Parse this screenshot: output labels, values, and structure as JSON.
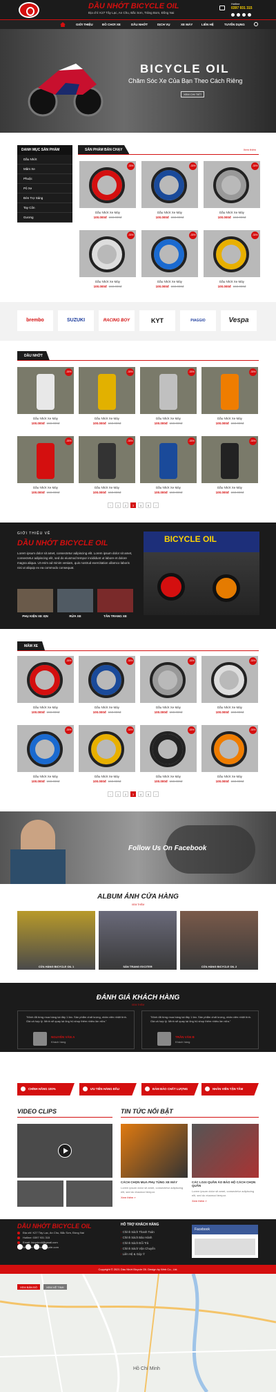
{
  "header": {
    "site_name": "DẦU NHỚT BICYCLE OIL",
    "address": "Địa chỉ: K27 Tây Lạc, An Chu, Bắc Sơn, Trảng Bom, Đồng Nai",
    "hotline_label": "Hotline",
    "hotline": "0397 931 315"
  },
  "nav": {
    "items": [
      "GIỚI THIỆU",
      "ĐỒ CHƠI XE",
      "DẦU NHỚT",
      "DỊCH VỤ",
      "XE MÁY",
      "LIÊN HỆ",
      "TUYỂN DỤNG"
    ]
  },
  "hero": {
    "title": "BICYCLE OIL",
    "subtitle": "Chăm Sóc Xe Của Bạn Theo Cách Riêng",
    "button": "XEM CHI TIẾT"
  },
  "sidebar": {
    "title": "DANH MỤC SẢN PHẨM",
    "items": [
      "Dầu Nhớt",
      "Mâm Xe",
      "Phuộc",
      "Pô Xe",
      "Đèn Trợ Sáng",
      "Tay Côn",
      "Gương"
    ]
  },
  "bestsellers": {
    "title": "SẢN PHẨM BÁN CHẠY",
    "see_all": "Xem thêm",
    "products": [
      {
        "name": "Dầu Nhớt Xe Máy",
        "price": "100.000đ",
        "old": "150.000đ",
        "badge": "-33%"
      },
      {
        "name": "Dầu Nhớt Xe Máy",
        "price": "100.000đ",
        "old": "150.000đ",
        "badge": "-33%"
      },
      {
        "name": "Dầu Nhớt Xe Máy",
        "price": "100.000đ",
        "old": "150.000đ",
        "badge": "-33%"
      },
      {
        "name": "Dầu Nhớt Xe Máy",
        "price": "100.000đ",
        "old": "150.000đ",
        "badge": "-33%"
      },
      {
        "name": "Dầu Nhớt Xe Máy",
        "price": "100.000đ",
        "old": "150.000đ",
        "badge": "-33%"
      },
      {
        "name": "Dầu Nhớt Xe Máy",
        "price": "100.000đ",
        "old": "150.000đ",
        "badge": "-33%"
      }
    ]
  },
  "brands": [
    "brembo",
    "SUZUKI",
    "RACING BOY",
    "KYT",
    "PIAGGIO",
    "Vespa"
  ],
  "oil": {
    "title": "DẦU NHỚT",
    "products": [
      {
        "name": "Dầu Nhớt Xe Máy",
        "price": "100.000đ",
        "old": "150.000đ",
        "badge": "-33%"
      },
      {
        "name": "Dầu Nhớt Xe Máy",
        "price": "100.000đ",
        "old": "150.000đ",
        "badge": "-33%"
      },
      {
        "name": "Dầu Nhớt Xe Máy",
        "price": "100.000đ",
        "old": "150.000đ",
        "badge": "-33%"
      },
      {
        "name": "Dầu Nhớt Xe Máy",
        "price": "100.000đ",
        "old": "150.000đ",
        "badge": "-33%"
      },
      {
        "name": "Dầu Nhớt Xe Máy",
        "price": "100.000đ",
        "old": "150.000đ",
        "badge": "-33%"
      },
      {
        "name": "Dầu Nhớt Xe Máy",
        "price": "100.000đ",
        "old": "150.000đ",
        "badge": "-33%"
      },
      {
        "name": "Dầu Nhớt Xe Máy",
        "price": "100.000đ",
        "old": "150.000đ",
        "badge": "-33%"
      },
      {
        "name": "Dầu Nhớt Xe Máy",
        "price": "100.000đ",
        "old": "150.000đ",
        "badge": "-33%"
      }
    ],
    "pages": [
      "‹",
      "1",
      "2",
      "3",
      "4",
      "5",
      "›"
    ]
  },
  "about": {
    "kicker": "GIỚI THIỆU VỀ",
    "title": "DẦU NHỚT BICYCLE OIL",
    "text": "Lorem ipsum dolor sit amet, consectetur adipiscing elit. Lorem ipsum dolor sit amet, consectetur adipiscing elit, sed do eiusmod tempor incididunt ut labore et dolore magna aliqua. Ut enim ad minim veniam, quis nostrud exercitation ullamco laboris nisi ut aliquip ex ea commodo consequat.",
    "thumbs": [
      "PHỤ KIỆN XE XỊN",
      "RỬA XE",
      "TÂN TRANG XE"
    ],
    "shop_sign": "BICYCLE OIL"
  },
  "wheels": {
    "title": "MÂM XE",
    "products": [
      {
        "name": "Dầu Nhớt Xe Máy",
        "price": "100.000đ",
        "old": "150.000đ",
        "badge": "-33%"
      },
      {
        "name": "Dầu Nhớt Xe Máy",
        "price": "100.000đ",
        "old": "150.000đ",
        "badge": "-33%"
      },
      {
        "name": "Dầu Nhớt Xe Máy",
        "price": "100.000đ",
        "old": "150.000đ",
        "badge": "-33%"
      },
      {
        "name": "Dầu Nhớt Xe Máy",
        "price": "100.000đ",
        "old": "150.000đ",
        "badge": "-33%"
      },
      {
        "name": "Dầu Nhớt Xe Máy",
        "price": "100.000đ",
        "old": "150.000đ",
        "badge": "-33%"
      },
      {
        "name": "Dầu Nhớt Xe Máy",
        "price": "100.000đ",
        "old": "150.000đ",
        "badge": "-33%"
      },
      {
        "name": "Dầu Nhớt Xe Máy",
        "price": "100.000đ",
        "old": "150.000đ",
        "badge": "-33%"
      },
      {
        "name": "Dầu Nhớt Xe Máy",
        "price": "100.000đ",
        "old": "150.000đ",
        "badge": "-33%"
      }
    ],
    "pages": [
      "‹",
      "1",
      "2",
      "3",
      "4",
      "5",
      "›"
    ]
  },
  "facebook_banner": "Follow Us On Facebook",
  "album": {
    "title": "ALBUM ẢNH CỬA HÀNG",
    "sub": "XEM THÊM",
    "items": [
      "CỬA HÀNG BICYCLE OIL 1",
      "SẢN TRANG EXCITER",
      "CỬA HÀNG BICYCLE OIL 2"
    ]
  },
  "reviews": {
    "title": "ĐÁNH GIÁ KHÁCH HÀNG",
    "sub": "XEM THÊM",
    "items": [
      {
        "text": "\"Mình đã từng mua hàng tại đây 1 lần. Sản phẩm chất lượng, nhân viên nhiệt tình. Giá cả hợp lý. Mình sẽ quay lại ủng hộ shop thêm nhiều lần nữa.\"",
        "name": "NGUYỄN VĂN A",
        "role": "Khách hàng"
      },
      {
        "text": "\"Mình đã từng mua hàng tại đây 1 lần. Sản phẩm chất lượng, nhân viên nhiệt tình. Giá cả hợp lý. Mình sẽ quay lại ủng hộ shop thêm nhiều lần nữa.\"",
        "name": "TRẦN VĂN B",
        "role": "Khách hàng"
      }
    ]
  },
  "features": [
    "CHÍNH HÃNG 100%",
    "ƯU TIÊN HÀNG ĐẦU",
    "ĐẢM BẢO CHẤT LƯỢNG",
    "NHÂN VIÊN TẬN TÂM"
  ],
  "videos": {
    "title": "VIDEO CLIPS"
  },
  "news": {
    "title": "TIN TỨC NỔI BẬT",
    "items": [
      {
        "title": "CÁCH CHỌN MUA PHỤ TÙNG XE MÁY",
        "text": "Lorem ipsum dolor sit amet, consectetur adipiscing elit, sed do eiusmod tempor.",
        "more": "Xem thêm »"
      },
      {
        "title": "CÁC LOẠI QUẦN ÁO BẢO HỘ CÁCH CHỌN QUẦN",
        "text": "Lorem ipsum dolor sit amet, consectetur adipiscing elit, sed do eiusmod tempor.",
        "more": "Xem thêm »"
      }
    ]
  },
  "footer": {
    "title": "DẦU NHỚT BICYCLE OIL",
    "lines": [
      "Địa chỉ: K27 Tây Lạc, An Chu, Bắc Sơn, Đồng Nai",
      "Hotline: 0397 931 315",
      "Email: bicycleoil@gmail.com",
      "Website: daunhotbicycle.com"
    ],
    "support_title": "HỖ TRỢ KHÁCH HÀNG",
    "support": [
      "Chính Sách Thanh Toán",
      "Chính Sách Bảo Hành",
      "Chính Sách Đổi Trả",
      "Chính Sách Vận Chuyển",
      "Liên Hệ & Góp Ý"
    ],
    "fb_page": "Facebook",
    "copyright": "Copyright © 2021 Dầu Nhớt Bicycle Oil. Design by Web Co., Ltd."
  },
  "map": {
    "btn1": "XEM BẢN ĐỒ",
    "btn2": "XEM VỆ TINH",
    "label": "Hồ Chí Minh"
  },
  "colors": {
    "accent": "#d40f0f",
    "dark": "#1b1b1b"
  }
}
